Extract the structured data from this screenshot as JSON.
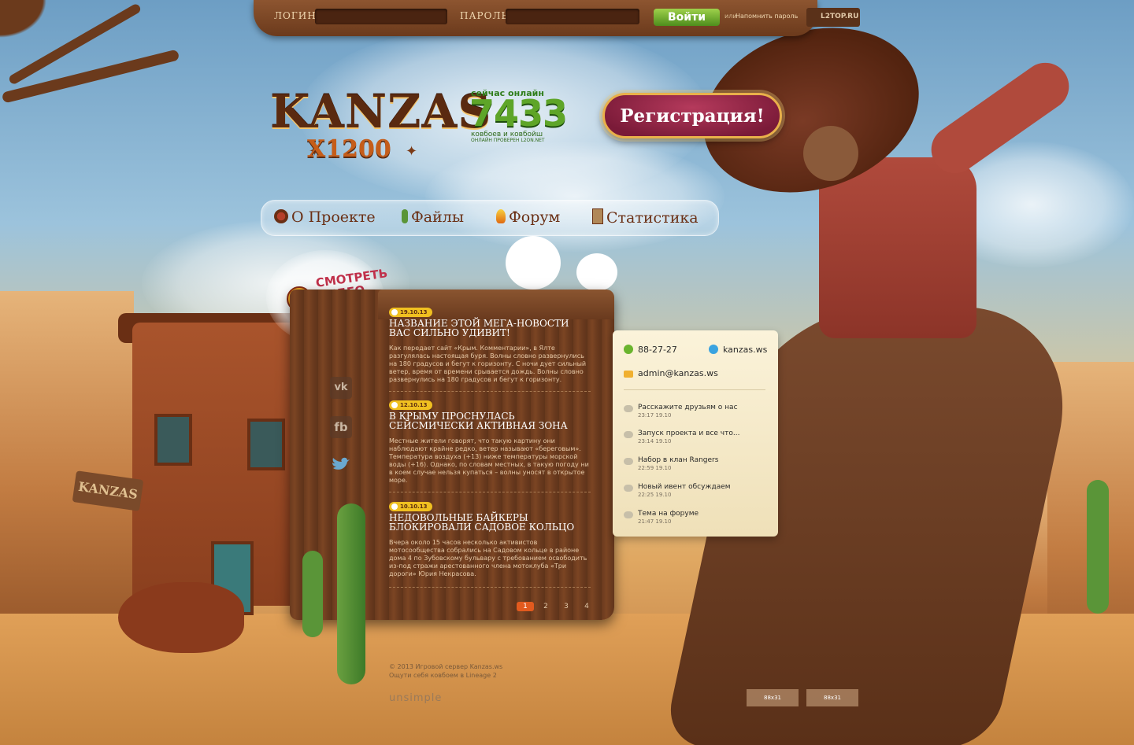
{
  "login": {
    "login_label": "ЛОГИН:",
    "login_value": "",
    "password_label": "ПАРОЛЬ:",
    "password_value": "",
    "submit_label": "Войти",
    "or_text": "или",
    "remind_label": "Напомнить пароль",
    "top_badge": "L2TOP.RU"
  },
  "logo": {
    "title": "KANZAS",
    "subtitle": "X1200"
  },
  "online": {
    "caption": "сейчас онлайн",
    "count": "7433",
    "sub": "ковбоев и ковбойш",
    "sub2": "ОНЛАЙН ПРОВЕРЕН L2ON.NET"
  },
  "register_label": "Регистрация!",
  "nav": {
    "items": [
      {
        "label": "О Проекте",
        "icon": "cow-skull-icon"
      },
      {
        "label": "Файлы",
        "icon": "cactus-icon"
      },
      {
        "label": "Форум",
        "icon": "fire-icon"
      },
      {
        "label": "Статистика",
        "icon": "poster-icon"
      }
    ]
  },
  "video_label_1": "Смотреть",
  "video_label_2": "видео",
  "social": {
    "vk": "vk",
    "fb": "fb",
    "tw": "twitter-icon"
  },
  "news": [
    {
      "date": "19.10.13",
      "title": "НАЗВАНИЕ ЭТОЙ МЕГА-НОВОСТИ ВАС СИЛЬНО УДИВИТ!",
      "text": "Как передает сайт «Крым. Комментарии», в Ялте разгулялась настоящая буря. Волны словно развернулись на 180 градусов и бегут к горизонту. С ночи дует сильный ветер, время от времени срывается дождь. Волны словно развернулись на 180 градусов и бегут к горизонту."
    },
    {
      "date": "12.10.13",
      "title": "В КРЫМУ ПРОСНУЛАСЬ СЕЙСМИЧЕСКИ АКТИВНАЯ ЗОНА",
      "text": "Местные жители говорят, что такую картину они наблюдают крайне редко, ветер называют «береговым». Температура воздуха (+13) ниже температуры морской воды (+16). Однако, по словам местных, в такую погоду ни в коем случае нельзя купаться – волны уносят в открытое море."
    },
    {
      "date": "10.10.13",
      "title": "НЕДОВОЛЬНЫЕ БАЙКЕРЫ БЛОКИРОВАЛИ САДОВОЕ КОЛЬЦО",
      "text": "Вчера около 15 часов несколько активистов мотосообщества собрались на Садовом кольце в районе дома 4 по Зубовскому бульвару с требованием освободить из-под стражи арестованного члена мотоклуба «Три дороги» Юрия Некрасова."
    }
  ],
  "pager": [
    "1",
    "2",
    "3",
    "4"
  ],
  "contacts": {
    "icq": "88-27-27",
    "skype": "kanzas.ws",
    "email": "admin@kanzas.ws"
  },
  "feed": [
    {
      "title": "Расскажите друзьям о нас",
      "time": "23:17",
      "date": "19.10"
    },
    {
      "title": "Запуск проекта и все что...",
      "time": "23:14",
      "date": "19.10"
    },
    {
      "title": "Набор в клан Rangers",
      "time": "22:59",
      "date": "19.10"
    },
    {
      "title": "Новый ивент обсуждаем",
      "time": "22:25",
      "date": "19.10"
    },
    {
      "title": "Тема на форуме",
      "time": "21:47",
      "date": "19.10"
    }
  ],
  "footer": {
    "copyright": "© 2013 Игровой сервер Kanzas.ws",
    "tagline": "Ощути себя ковбоем в Lineage 2",
    "studio": "unsimple",
    "counter1": "88x31",
    "counter2": "88x31"
  },
  "sign_text": "KANZAS",
  "colors": {
    "accent_green": "#5ea528",
    "register": "#7a1a38",
    "wood": "#6a3a1e"
  }
}
